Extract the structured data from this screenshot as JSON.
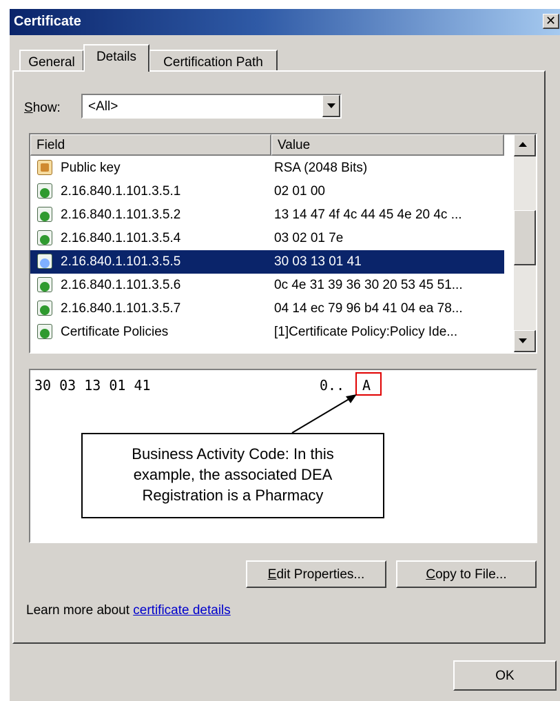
{
  "window": {
    "title": "Certificate",
    "close_glyph": "✕"
  },
  "tabs": [
    {
      "label": "General",
      "active": false
    },
    {
      "label": "Details",
      "active": true
    },
    {
      "label": "Certification Path",
      "active": false
    }
  ],
  "show": {
    "label_prefix": "S",
    "label_rest": "how:",
    "selected": "<All>"
  },
  "table": {
    "columns": [
      "Field",
      "Value"
    ],
    "rows": [
      {
        "icon": "public-key-icon",
        "field": "Public key",
        "value": "RSA (2048 Bits)",
        "selected": false
      },
      {
        "icon": "extension-icon",
        "field": "2.16.840.1.101.3.5.1",
        "value": "02 01 00",
        "selected": false
      },
      {
        "icon": "extension-icon",
        "field": "2.16.840.1.101.3.5.2",
        "value": "13 14 47 4f 4c 44 45 4e 20 4c ...",
        "selected": false
      },
      {
        "icon": "extension-icon",
        "field": "2.16.840.1.101.3.5.4",
        "value": "03 02 01 7e",
        "selected": false
      },
      {
        "icon": "extension-icon",
        "field": "2.16.840.1.101.3.5.5",
        "value": "30 03 13 01 41",
        "selected": true
      },
      {
        "icon": "extension-icon",
        "field": "2.16.840.1.101.3.5.6",
        "value": "0c 4e 31 39 36 30 20 53 45 51...",
        "selected": false
      },
      {
        "icon": "extension-icon",
        "field": "2.16.840.1.101.3.5.7",
        "value": "04 14 ec 79 96 b4 41 04 ea 78...",
        "selected": false
      },
      {
        "icon": "extension-icon",
        "field": "Certificate Policies",
        "value": "[1]Certificate Policy:Policy Ide...",
        "selected": false
      }
    ]
  },
  "detail": {
    "hex": "30 03 13 01 41",
    "ascii_prefix": "0..",
    "ascii_highlight": "A",
    "callout": [
      "Business Activity Code: In this",
      "example, the associated DEA",
      "Registration is a Pharmacy"
    ]
  },
  "buttons": {
    "edit_mnemonic": "E",
    "edit_rest": "dit Properties...",
    "copy_mnemonic": "C",
    "copy_rest": "opy to File...",
    "ok": "OK"
  },
  "learn_more": {
    "prefix": "Learn more about ",
    "link": "certificate details"
  },
  "colors": {
    "selection": "#0a246a",
    "highlight_border": "#e00000",
    "link": "#0000cc",
    "dialog_bg": "#d6d3ce"
  }
}
